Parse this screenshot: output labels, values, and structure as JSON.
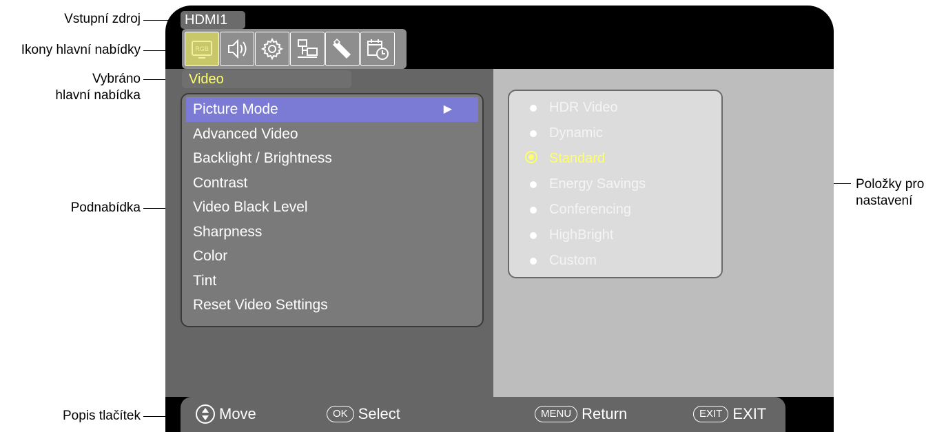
{
  "callouts": {
    "input_source": "Vstupní zdroj",
    "main_menu_icons": "Ikony hlavní nabídky",
    "selected_main_line1": "Vybráno",
    "selected_main_line2": "hlavní nabídka",
    "submenu": "Podnabídka",
    "buttons": "Popis tlačítek",
    "settings_line1": "Položky pro",
    "settings_line2": "nastavení"
  },
  "osd": {
    "input_source": "HDMI1",
    "main_menu_icons": [
      {
        "name": "rgb-video-icon",
        "label": "RGB",
        "active": true
      },
      {
        "name": "speaker-icon",
        "active": false
      },
      {
        "name": "gear-icon",
        "active": false
      },
      {
        "name": "network-icon",
        "active": false
      },
      {
        "name": "usb-stick-icon",
        "active": false
      },
      {
        "name": "schedule-icon",
        "active": false
      }
    ],
    "selected_menu": "Video",
    "submenu_items": [
      "Picture Mode",
      "Advanced Video",
      "Backlight / Brightness",
      "Contrast",
      "Video Black Level",
      "Sharpness",
      "Color",
      "Tint",
      "Reset Video Settings"
    ],
    "highlighted_submenu": "Picture Mode",
    "options": [
      "HDR Video",
      "Dynamic",
      "Standard",
      "Energy Savings",
      "Conferencing",
      "HighBright",
      "Custom"
    ],
    "selected_option": "Standard",
    "buttons": {
      "move_label": "Move",
      "ok_key": "OK",
      "select_label": "Select",
      "menu_key": "MENU",
      "return_label": "Return",
      "exit_key": "EXIT",
      "exit_label": "EXIT"
    },
    "colors": {
      "highlight": "#7b7bd6",
      "selected_text": "#ffff66"
    }
  }
}
